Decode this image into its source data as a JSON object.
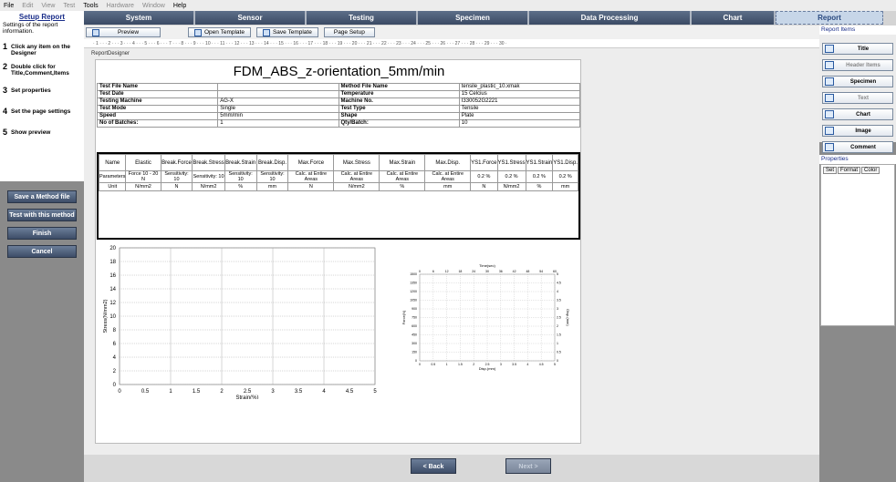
{
  "menu": [
    "File",
    "Edit",
    "View",
    "Test",
    "Tools",
    "Hardware",
    "Window",
    "Help"
  ],
  "menu_enabled": [
    true,
    false,
    false,
    false,
    true,
    false,
    false,
    true
  ],
  "nav": [
    "System",
    "Sensor",
    "Testing",
    "Specimen",
    "Data Processing",
    "Chart",
    "Report"
  ],
  "left": {
    "title": "Setup Report",
    "desc": "Settings of the report information.",
    "steps": [
      {
        "num": "1",
        "text": "Click any item on the Designer"
      },
      {
        "num": "2",
        "text": "Double click for Title,Comment,Items"
      },
      {
        "num": "3",
        "text": "Set properties"
      },
      {
        "num": "4",
        "text": "Set the page settings"
      },
      {
        "num": "5",
        "text": "Show preview"
      }
    ],
    "buttons": [
      "Save a Method file",
      "Test with this method",
      "Finish",
      "Cancel"
    ]
  },
  "toolbar": {
    "preview": "Preview",
    "open_template": "Open Template",
    "save_template": "Save Template",
    "page_setup": "Page Setup"
  },
  "ruler": "· 1 · · · 2 · · · 3 · · · 4 · · · 5 · · · 6 · · · 7 · · · 8 · · · 9 · · · 10 · · · 11 · · · 12 · · · 13 · · · 14 · · · 15 · · · 16 · · · 17 · · · 18 · · · 19 · · · 20 · · · 21 · · · 22 · · · 23 · · · 24 · · · 25 · · · 26 · · · 27 · · · 28 · · · 29 · · · 30 ·",
  "doc_tab": "ReportDesigner",
  "report": {
    "title": "FDM_ABS_z-orientation_5mm/min",
    "info": [
      [
        "Test File Name",
        "",
        "Method File Name",
        "tensile_plastic_10.xmak"
      ],
      [
        "Test Date",
        "",
        "Temperature",
        "15 Celcius"
      ],
      [
        "Testing Machine",
        "AG-X",
        "Machine No.",
        "I330052G2221"
      ],
      [
        "Test Mode",
        "Single",
        "Test Type",
        "Tensile"
      ],
      [
        "Speed",
        "5mm/min",
        "Shape",
        "Plate"
      ],
      [
        "No of Batches:",
        "1",
        "Qty/Batch:",
        "10"
      ]
    ],
    "results_header": [
      "Name",
      "Elastic",
      "Break.Force",
      "Break.Stress",
      "Break.Strain",
      "Break.Disp.",
      "Max.Force",
      "Max.Stress",
      "Max.Strain",
      "Max.Disp.",
      "YS1.Force",
      "YS1.Stress",
      "YS1.Strain",
      "YS1.Disp."
    ],
    "results_params": [
      "Parameters",
      "Force 10 - 20 N",
      "Sensitivity: 10",
      "Sensitivity: 10",
      "Sensitivity: 10",
      "Sensitivity: 10",
      "Calc. at Entire Areas",
      "Calc. at Entire Areas",
      "Calc. at Entire Areas",
      "Calc. at Entire Areas",
      "0.2 %",
      "0.2 %",
      "0.2 %",
      "0.2 %"
    ],
    "results_units": [
      "Unit",
      "N/mm2",
      "N",
      "N/mm2",
      "%",
      "mm",
      "N",
      "N/mm2",
      "%",
      "mm",
      "N",
      "N/mm2",
      "%",
      "mm"
    ]
  },
  "chart_data": [
    {
      "type": "line",
      "xlabel": "Strain(%)",
      "ylabel": "Stress(N/mm2)",
      "xlim": [
        0,
        5
      ],
      "ylim": [
        0,
        20
      ],
      "xticks": [
        "0",
        "0.5",
        "1",
        "1.5",
        "2",
        "2.5",
        "3",
        "3.5",
        "4",
        "4.5",
        "5"
      ],
      "yticks": [
        "0",
        "2",
        "4",
        "6",
        "8",
        "10",
        "12",
        "14",
        "16",
        "18",
        "20"
      ],
      "grid": true,
      "series": []
    },
    {
      "type": "line",
      "xlabel": "Disp.(mm)",
      "ylabel": "Force(N)",
      "x2label": "Time(sec)",
      "y2label": "Disp.(mm)",
      "xticks": [
        "0",
        "0.5",
        "1",
        "1.5",
        "2",
        "2.5",
        "3",
        "3.5",
        "4",
        "4.5",
        "5"
      ],
      "x2ticks": [
        "0",
        "6",
        "12",
        "18",
        "24",
        "30",
        "36",
        "42",
        "48",
        "54",
        "60"
      ],
      "yticks": [
        "0",
        "150",
        "300",
        "450",
        "600",
        "750",
        "900",
        "1050",
        "1200",
        "1350",
        "1500"
      ],
      "y2ticks": [
        "0",
        "0.5",
        "1",
        "1.5",
        "2",
        "2.5",
        "3",
        "3.5",
        "4",
        "4.5",
        "5"
      ],
      "grid": true,
      "series": []
    }
  ],
  "right": {
    "header": "Report Items",
    "items": [
      "Title",
      "Header Items",
      "Specimen",
      "Text",
      "Chart",
      "Image",
      "Comment"
    ],
    "items_enabled": [
      true,
      false,
      true,
      false,
      true,
      true,
      true
    ],
    "properties": "Properties",
    "tabs": [
      "Set",
      "Format",
      "Color"
    ]
  },
  "bottom": {
    "back": "< Back",
    "next": "Next >"
  },
  "colors": {
    "nav": "#3b4a64",
    "active_nav": "#c7d6e8",
    "accent": "#1a2e8a"
  }
}
